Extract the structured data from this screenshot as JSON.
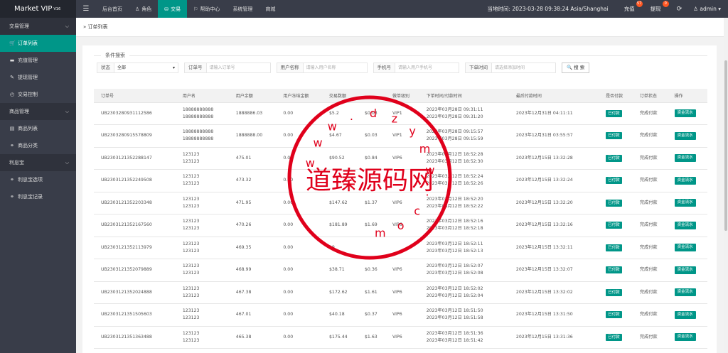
{
  "app": {
    "title": "Market VIP",
    "version": "V16"
  },
  "topnav": {
    "items": [
      {
        "icon": "",
        "label": "后台首页"
      },
      {
        "icon": "♙",
        "label": "角色"
      },
      {
        "icon": "⛁",
        "label": "交易"
      },
      {
        "icon": "⚐",
        "label": "帮助中心"
      },
      {
        "icon": "",
        "label": "系统管理"
      },
      {
        "icon": "",
        "label": "商城"
      }
    ],
    "active_index": 2
  },
  "header_right": {
    "time_label": "当地时间: 2023-03-28 09:38:24  Asia/Shanghai",
    "recharge_label": "充值",
    "recharge_badge": "57",
    "withdraw_label": "提现",
    "withdraw_badge": "0",
    "refresh_icon": "⟳",
    "admin_label": "♙ admin ▾"
  },
  "sidebar": {
    "groups": [
      {
        "label": "交易管理",
        "items": [
          {
            "icon": "🛒",
            "label": "订单列表",
            "active": true
          },
          {
            "icon": "▬",
            "label": "充值管理"
          },
          {
            "icon": "✎",
            "label": "提现管理"
          },
          {
            "icon": "◴",
            "label": "交易控制"
          }
        ]
      },
      {
        "label": "商品管理",
        "items": [
          {
            "icon": "▤",
            "label": "商品列表"
          },
          {
            "icon": "⚭",
            "label": "商品分类"
          }
        ]
      },
      {
        "label": "利息宝",
        "items": [
          {
            "icon": "⚭",
            "label": "利息宝选项"
          },
          {
            "icon": "⚭",
            "label": "利息宝记录"
          }
        ]
      }
    ]
  },
  "breadcrumb": "» 订单列表",
  "search": {
    "legend": "条件搜索",
    "status_label": "状态",
    "status_value": "全部",
    "order_label": "订单号",
    "order_placeholder": "请输入订单号",
    "user_label": "用户名称",
    "user_placeholder": "请输入用户名称",
    "phone_label": "手机号",
    "phone_placeholder": "请输入用户手机号",
    "time_label": "下单时间",
    "time_placeholder": "请选择添加时间",
    "button_label": "🔍 搜 索"
  },
  "table": {
    "headers": [
      "订单号",
      "用户名",
      "用户余额",
      "用户冻结金额",
      "交易数额",
      "",
      "做单级别",
      "下单时间/付款时间",
      "最后付款时间",
      "是否付款",
      "订单状态",
      "操作"
    ],
    "rows": [
      {
        "id": "UB2303280931112586",
        "user1": "18888888888",
        "user2": "18888888888",
        "balance": "1888886.03",
        "frozen": "0.00",
        "amount": "$5.2",
        "commission": "$0.03",
        "level": "VIP1",
        "t1": "2023年03月28日 09:31:11",
        "t2": "2023年03月28日 09:31:20",
        "last": "2023年12月31日 04:11:11",
        "paid": "已付款",
        "status": "完成付款",
        "action": "资金流水"
      },
      {
        "id": "UB2303280915578809",
        "user1": "18888888888",
        "user2": "18888888888",
        "balance": "1888888.00",
        "frozen": "0.00",
        "amount": "$4.67",
        "commission": "$0.03",
        "level": "VIP1",
        "t1": "2023年03月28日 09:15:57",
        "t2": "2023年03月28日 09:15:59",
        "last": "2023年12月31日 03:55:57",
        "paid": "已付款",
        "status": "完成付款",
        "action": "资金流水"
      },
      {
        "id": "UB2303121352288147",
        "user1": "123123",
        "user2": "123123",
        "balance": "475.01",
        "frozen": "0.00",
        "amount": "$90.52",
        "commission": "$0.84",
        "level": "VIP6",
        "t1": "2023年03月12日 18:52:28",
        "t2": "2023年03月12日 18:52:30",
        "last": "2023年12月15日 13:32:28",
        "paid": "已付款",
        "status": "完成付款",
        "action": "资金流水"
      },
      {
        "id": "UB2303121352249508",
        "user1": "123123",
        "user2": "123123",
        "balance": "473.32",
        "frozen": "0.00",
        "amount": "",
        "commission": "",
        "level": "",
        "t1": "2023年03月12日 18:52:24",
        "t2": "2023年03月12日 18:52:26",
        "last": "2023年12月15日 13:32:24",
        "paid": "已付款",
        "status": "完成付款",
        "action": "资金流水"
      },
      {
        "id": "UB2303121352203348",
        "user1": "123123",
        "user2": "123123",
        "balance": "471.95",
        "frozen": "0.00",
        "amount": "$147.62",
        "commission": "$1.37",
        "level": "VIP6",
        "t1": "2023年03月12日 18:52:20",
        "t2": "2023年03月12日 18:52:22",
        "last": "2023年12月15日 13:32:20",
        "paid": "已付款",
        "status": "完成付款",
        "action": "资金流水"
      },
      {
        "id": "UB2303121352167560",
        "user1": "123123",
        "user2": "123123",
        "balance": "470.26",
        "frozen": "0.00",
        "amount": "$181.89",
        "commission": "$1.69",
        "level": "VIP6",
        "t1": "2023年03月12日 18:52:16",
        "t2": "2023年03月12日 18:52:18",
        "last": "2023年12月15日 13:32:16",
        "paid": "已付款",
        "status": "完成付款",
        "action": "资金流水"
      },
      {
        "id": "UB2303121352113979",
        "user1": "123123",
        "user2": "123123",
        "balance": "469.35",
        "frozen": "0.00",
        "amount": "$9",
        "commission": "",
        "level": "",
        "t1": "2023年03月12日 18:52:11",
        "t2": "2023年03月12日 18:52:13",
        "last": "2023年12月15日 13:32:11",
        "paid": "已付款",
        "status": "完成付款",
        "action": "资金流水"
      },
      {
        "id": "UB2303121352079889",
        "user1": "123123",
        "user2": "123123",
        "balance": "468.99",
        "frozen": "0.00",
        "amount": "$38.71",
        "commission": "$0.36",
        "level": "VIP6",
        "t1": "2023年03月12日 18:52:07",
        "t2": "2023年03月12日 18:52:08",
        "last": "2023年12月15日 13:32:07",
        "paid": "已付款",
        "status": "完成付款",
        "action": "资金流水"
      },
      {
        "id": "UB2303121352024888",
        "user1": "123123",
        "user2": "123123",
        "balance": "467.38",
        "frozen": "0.00",
        "amount": "$172.62",
        "commission": "$1.61",
        "level": "VIP6",
        "t1": "2023年03月12日 18:52:02",
        "t2": "2023年03月12日 18:52:04",
        "last": "2023年12月15日 13:32:02",
        "paid": "已付款",
        "status": "完成付款",
        "action": "资金流水"
      },
      {
        "id": "UB2303121351505603",
        "user1": "123123",
        "user2": "123123",
        "balance": "467.01",
        "frozen": "0.00",
        "amount": "$40.18",
        "commission": "$0.37",
        "level": "VIP6",
        "t1": "2023年03月12日 18:51:50",
        "t2": "2023年03月12日 18:51:58",
        "last": "2023年12月15日 13:31:50",
        "paid": "已付款",
        "status": "完成付款",
        "action": "资金流水"
      },
      {
        "id": "UB2303121351363488",
        "user1": "123123",
        "user2": "123123",
        "balance": "465.38",
        "frozen": "0.00",
        "amount": "$175.44",
        "commission": "$1.63",
        "level": "VIP6",
        "t1": "2023年03月12日 18:51:36",
        "t2": "2023年03月12日 18:51:42",
        "last": "2023年12月15日 13:31:36",
        "paid": "已付款",
        "status": "完成付款",
        "action": "资金流水"
      }
    ]
  },
  "watermark": {
    "main_text": "道臻源码网",
    "url_chars": [
      "w",
      "w",
      "w",
      ".",
      "d",
      "z",
      "y",
      "m",
      "w",
      ".",
      "c",
      "o",
      "m"
    ],
    "color": "#e0001b"
  },
  "colors": {
    "accent": "#009688",
    "topbar": "#393d49",
    "badge": "#ff5722"
  }
}
